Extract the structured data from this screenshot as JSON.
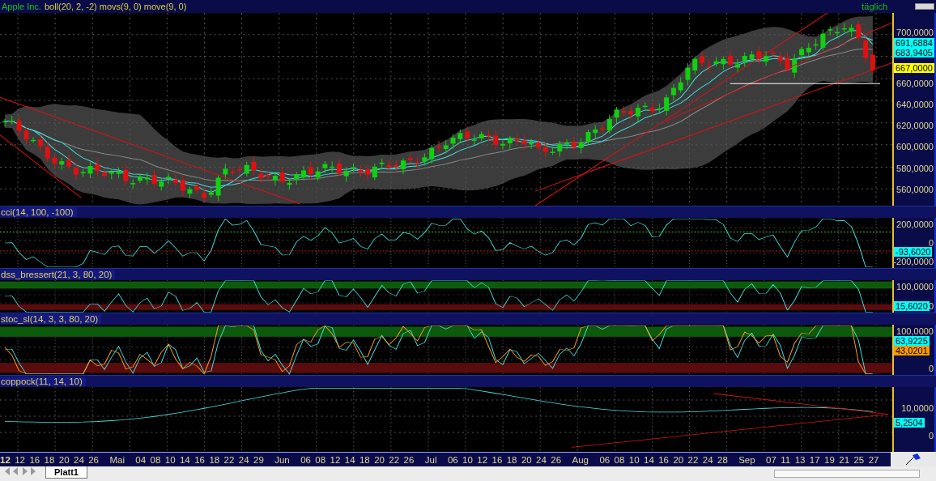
{
  "header": {
    "symbol": "Apple Inc.",
    "indicators": "boll(20, 2, -2) movs(9, 0) move(9, 0)",
    "period": "täglich"
  },
  "panels": [
    {
      "kind": "price",
      "axis_labels": [
        "700,0000",
        "660,0000",
        "640,0000",
        "620,0000",
        "600,0000",
        "580,0000",
        "560,0000"
      ],
      "badges": [
        {
          "text": "691,6884",
          "color": "#00ffff"
        },
        {
          "text": "683,9405",
          "color": "#00ffff"
        },
        {
          "text": "667,0000",
          "color": "#ffff00"
        }
      ]
    },
    {
      "kind": "cci",
      "title": "cci(14, 100, -100)",
      "axis_labels": [
        "200,0000",
        "0",
        "-200,0000"
      ],
      "badges": [
        {
          "text": "-93,6020",
          "color": "#00ffff"
        }
      ]
    },
    {
      "kind": "dss",
      "title": "dss_bressert(21, 3, 80, 20)",
      "axis_labels": [
        "100,0000",
        "0"
      ],
      "badges": [
        {
          "text": "15,6020",
          "color": "#00ffff"
        }
      ]
    },
    {
      "kind": "stoc",
      "title": "stoc_sl(14, 3, 3, 80, 20)",
      "axis_labels": [
        "100,0000",
        "0"
      ],
      "badges": [
        {
          "text": "63,9225",
          "color": "#00ffff"
        },
        {
          "text": "43,0201",
          "color": "#ff9900"
        }
      ]
    },
    {
      "kind": "coppock",
      "title": "coppock(11, 14, 10)",
      "axis_labels": [
        "10,0000",
        "0"
      ],
      "badges": [
        {
          "text": "5,2504",
          "color": "#00ffff"
        }
      ]
    }
  ],
  "date_axis": {
    "labels": [
      {
        "text": "12",
        "kind": "year"
      },
      {
        "text": "12",
        "kind": "day"
      },
      {
        "text": "16",
        "kind": "day"
      },
      {
        "text": "18",
        "kind": "day"
      },
      {
        "text": "20",
        "kind": "day"
      },
      {
        "text": "24",
        "kind": "day"
      },
      {
        "text": "26",
        "kind": "day"
      },
      {
        "text": "Mai",
        "kind": "month"
      },
      {
        "text": "04",
        "kind": "day"
      },
      {
        "text": "08",
        "kind": "day"
      },
      {
        "text": "10",
        "kind": "day"
      },
      {
        "text": "14",
        "kind": "day"
      },
      {
        "text": "16",
        "kind": "day"
      },
      {
        "text": "18",
        "kind": "day"
      },
      {
        "text": "22",
        "kind": "day"
      },
      {
        "text": "24",
        "kind": "day"
      },
      {
        "text": "29",
        "kind": "day"
      },
      {
        "text": "Jun",
        "kind": "month"
      },
      {
        "text": "06",
        "kind": "day"
      },
      {
        "text": "08",
        "kind": "day"
      },
      {
        "text": "12",
        "kind": "day"
      },
      {
        "text": "14",
        "kind": "day"
      },
      {
        "text": "18",
        "kind": "day"
      },
      {
        "text": "20",
        "kind": "day"
      },
      {
        "text": "22",
        "kind": "day"
      },
      {
        "text": "26",
        "kind": "day"
      },
      {
        "text": "Jul",
        "kind": "month"
      },
      {
        "text": "06",
        "kind": "day"
      },
      {
        "text": "10",
        "kind": "day"
      },
      {
        "text": "12",
        "kind": "day"
      },
      {
        "text": "16",
        "kind": "day"
      },
      {
        "text": "18",
        "kind": "day"
      },
      {
        "text": "20",
        "kind": "day"
      },
      {
        "text": "24",
        "kind": "day"
      },
      {
        "text": "26",
        "kind": "day"
      },
      {
        "text": "Aug",
        "kind": "month"
      },
      {
        "text": "06",
        "kind": "day"
      },
      {
        "text": "08",
        "kind": "day"
      },
      {
        "text": "10",
        "kind": "day"
      },
      {
        "text": "14",
        "kind": "day"
      },
      {
        "text": "16",
        "kind": "day"
      },
      {
        "text": "20",
        "kind": "day"
      },
      {
        "text": "22",
        "kind": "day"
      },
      {
        "text": "24",
        "kind": "day"
      },
      {
        "text": "28",
        "kind": "day"
      },
      {
        "text": "Sep",
        "kind": "month"
      },
      {
        "text": "07",
        "kind": "day"
      },
      {
        "text": "11",
        "kind": "day"
      },
      {
        "text": "13",
        "kind": "day"
      },
      {
        "text": "17",
        "kind": "day"
      },
      {
        "text": "19",
        "kind": "day"
      },
      {
        "text": "21",
        "kind": "day"
      },
      {
        "text": "25",
        "kind": "day"
      },
      {
        "text": "27",
        "kind": "day"
      }
    ]
  },
  "sheet_tab": "Platt1"
}
